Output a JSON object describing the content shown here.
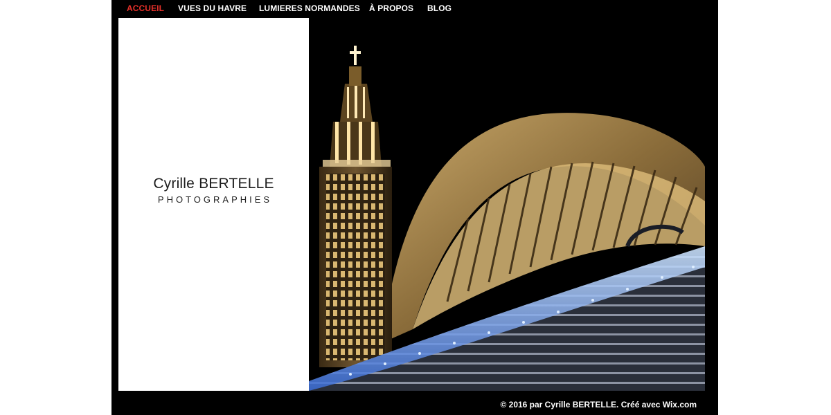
{
  "nav": {
    "items": [
      {
        "label": "ACCUEIL",
        "active": true
      },
      {
        "label": "VUES DU HAVRE",
        "active": false
      },
      {
        "label": "LUMIERES NORMANDES",
        "active": false
      },
      {
        "label": "À PROPOS",
        "active": false
      },
      {
        "label": "BLOG",
        "active": false
      }
    ]
  },
  "brand": {
    "name": "Cyrille BERTELLE",
    "subtitle": "PHOTOGRAPHIES"
  },
  "footer": {
    "text": "© 2016 par Cyrille BERTELLE. Créé avec Wix.com"
  },
  "colors": {
    "background": "#000000",
    "active_nav": "#e8312a",
    "panel": "#ffffff"
  }
}
